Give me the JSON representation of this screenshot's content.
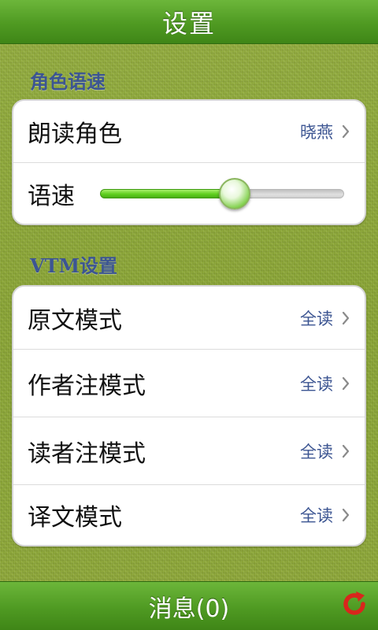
{
  "header": {
    "title": "设置"
  },
  "sections": [
    {
      "label": "角色语速",
      "rows": [
        {
          "label": "朗读角色",
          "value": "晓燕"
        },
        {
          "label": "语速",
          "slider_value": 0.55
        }
      ]
    },
    {
      "label": "VTM设置",
      "rows": [
        {
          "label": "原文模式",
          "value": "全读"
        },
        {
          "label": "作者注模式",
          "value": "全读"
        },
        {
          "label": "读者注模式",
          "value": "全读"
        },
        {
          "label": "译文模式",
          "value": "全读"
        }
      ]
    }
  ],
  "footer": {
    "message_label": "消息(0)",
    "refresh_icon": "refresh-icon"
  },
  "colors": {
    "accent_green": "#4f9a22",
    "value_blue": "#3c5592",
    "refresh_red": "#d9261c"
  }
}
